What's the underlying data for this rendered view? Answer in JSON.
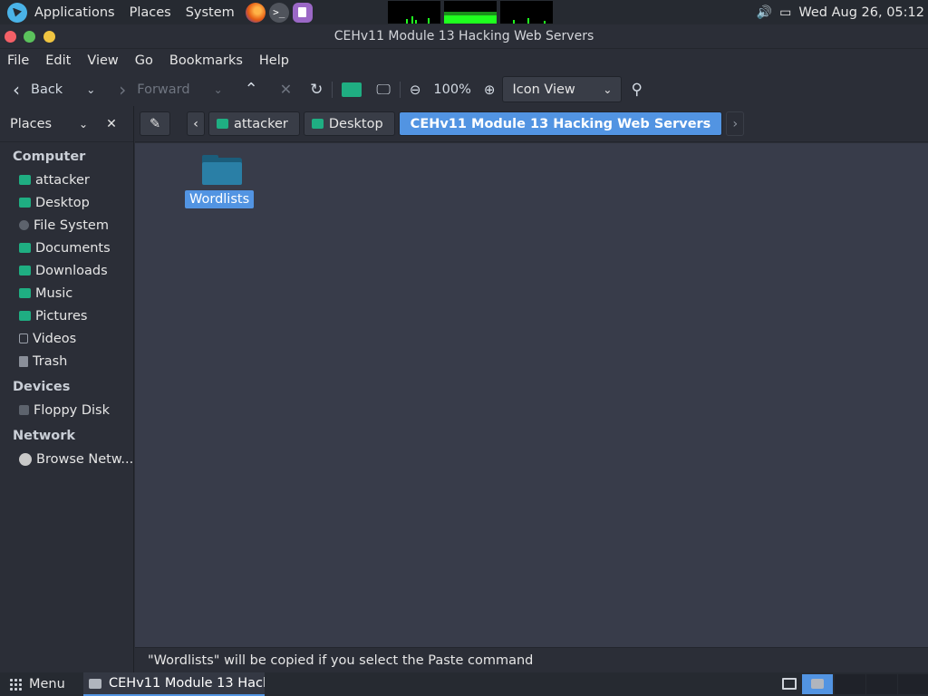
{
  "top_panel": {
    "menus": [
      "Applications",
      "Places",
      "System"
    ],
    "datetime": "Wed Aug 26, 05:12",
    "icons": [
      "kali-logo-icon",
      "firefox-icon",
      "terminal-icon",
      "text-editor-icon",
      "volume-icon",
      "display-icon"
    ]
  },
  "window": {
    "title": "CEHv11 Module 13 Hacking Web Servers"
  },
  "menubar": {
    "items": [
      "File",
      "Edit",
      "View",
      "Go",
      "Bookmarks",
      "Help"
    ]
  },
  "toolbar": {
    "back_label": "Back",
    "forward_label": "Forward",
    "zoom_level": "100%",
    "view_mode": "Icon View"
  },
  "sidebar": {
    "header": "Places",
    "sections": {
      "computer": "Computer",
      "devices": "Devices",
      "network": "Network"
    },
    "computer_items": [
      "attacker",
      "Desktop",
      "File System",
      "Documents",
      "Downloads",
      "Music",
      "Pictures",
      "Videos",
      "Trash"
    ],
    "device_items": [
      "Floppy Disk"
    ],
    "network_items": [
      "Browse Netw..."
    ]
  },
  "pathbar": {
    "crumbs": [
      "attacker",
      "Desktop",
      "CEHv11 Module 13 Hacking Web Servers"
    ]
  },
  "content": {
    "items": [
      {
        "name": "Wordlists",
        "type": "folder",
        "selected": true
      }
    ]
  },
  "status": "\"Wordlists\" will be copied if you select the Paste command",
  "bottom_panel": {
    "menu_label": "Menu",
    "task_label": "CEHv11 Module 13 Hack..."
  },
  "colors": {
    "accent": "#5294e2",
    "folder_green": "#1fae82",
    "monitor_green": "#1fff1f"
  }
}
